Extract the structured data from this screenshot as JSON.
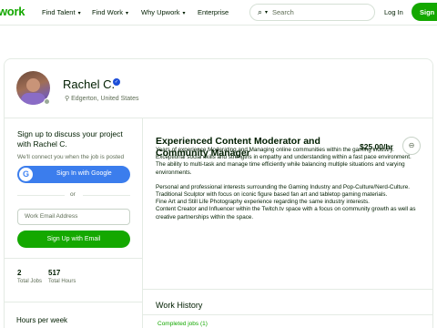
{
  "nav": {
    "logo": "work",
    "links": [
      "Find Talent",
      "Find Work",
      "Why Upwork",
      "Enterprise"
    ],
    "search_placeholder": "Search",
    "login": "Log In",
    "signup": "Sign"
  },
  "profile": {
    "name": "Rachel C.",
    "location": "Edgerton, United States"
  },
  "sidebar": {
    "heading": "Sign up to discuss your project with Rachel C.",
    "subtext": "We'll connect you when the job is posted",
    "google_button": "Sign In with Google",
    "or": "or",
    "email_placeholder": "Work Email Address",
    "email_button": "Sign Up with Email",
    "stats": [
      {
        "value": "2",
        "label": "Total Jobs"
      },
      {
        "value": "517",
        "label": "Total Hours"
      }
    ],
    "hours_label": "Hours per week"
  },
  "main": {
    "title": "Experienced Content Moderator and Community Manager",
    "rate": "$25.00/hr",
    "description": [
      "Years of experience Moderating and Managing online communities within the gaming industry.",
      "Exceptional social skills and strengths in empathy and understanding within a fast pace environment.",
      "The ability to multi-task and manage time efficiently while balancing multiple situations and varying environments.",
      "",
      "Personal and professional interests surrounding the Gaming Industry and Pop-Culture/Nerd-Culture.",
      "Traditional Sculptor with focus on iconic figure based fan art and tabletop gaming materials.",
      "Fine Art and Still Life Photography experience regarding the same industry interests.",
      "Content Creator and Influencer within the Twitch.tv space with a focus on community growth as well as creative partnerships within the space."
    ],
    "work_history_title": "Work History",
    "completed_jobs": "Completed jobs (1)"
  },
  "colors": {
    "brand_green": "#14a800",
    "google_blue": "#3b7ded",
    "verified_blue": "#1d4ed8"
  }
}
